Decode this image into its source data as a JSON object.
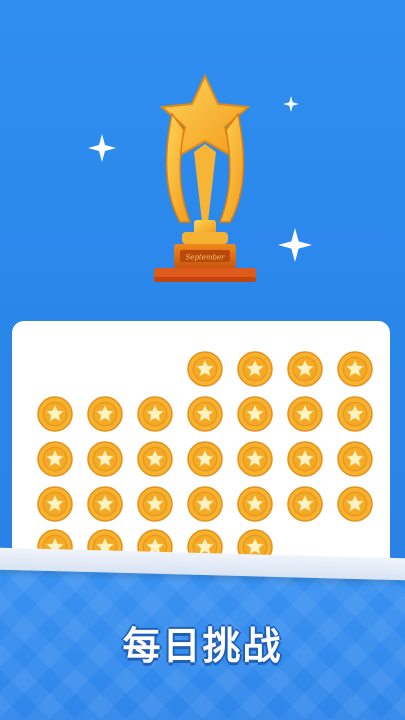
{
  "trophy": {
    "plate_text": "September"
  },
  "medals": {
    "rows": [
      [
        0,
        0,
        0,
        1,
        1,
        1,
        1
      ],
      [
        1,
        1,
        1,
        1,
        1,
        1,
        1
      ],
      [
        1,
        1,
        1,
        1,
        1,
        1,
        1
      ],
      [
        1,
        1,
        1,
        1,
        1,
        1,
        1
      ],
      [
        1,
        1,
        1,
        1,
        1,
        0,
        0
      ]
    ],
    "total_shown": 30
  },
  "footer": {
    "title": "每日挑战"
  },
  "colors": {
    "background": "#2b86ea",
    "medal": "#f0a020",
    "title_outline": "#1f5fb8"
  }
}
